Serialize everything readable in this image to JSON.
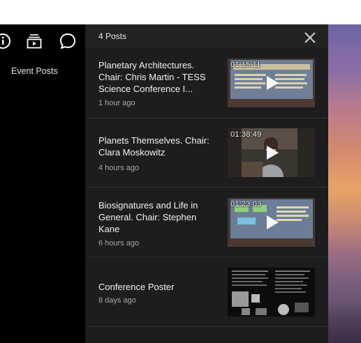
{
  "panel": {
    "title": "4 Posts"
  },
  "sidebar": {
    "label": "Event Posts",
    "icons": [
      "info-icon",
      "media-stack-icon",
      "chat-bubble-icon"
    ]
  },
  "posts": [
    {
      "title": "Planetary Architectures. Chair: Chris Martin - TESS Science Conference I...",
      "time": "1 hour ago",
      "duration": "01:15:11",
      "thumb": "slide-presentation"
    },
    {
      "title": "Planets Themselves. Chair: Clara Moskowitz",
      "time": "4 hours ago",
      "duration": "01:38:49",
      "thumb": "speaker"
    },
    {
      "title": "Biosignatures and Life in General. Chair: Stephen Kane",
      "time": "6 hours ago",
      "duration": "01:23:03",
      "thumb": "slide-presentation"
    },
    {
      "title": "Conference Poster",
      "time": "8 days ago",
      "duration": "",
      "thumb": "poster"
    }
  ],
  "colors": {
    "panel_bg": "#1d1d1d",
    "sidebar_bg": "#000000",
    "text_primary": "#f2f2f2",
    "text_secondary": "#a7a7a7"
  }
}
